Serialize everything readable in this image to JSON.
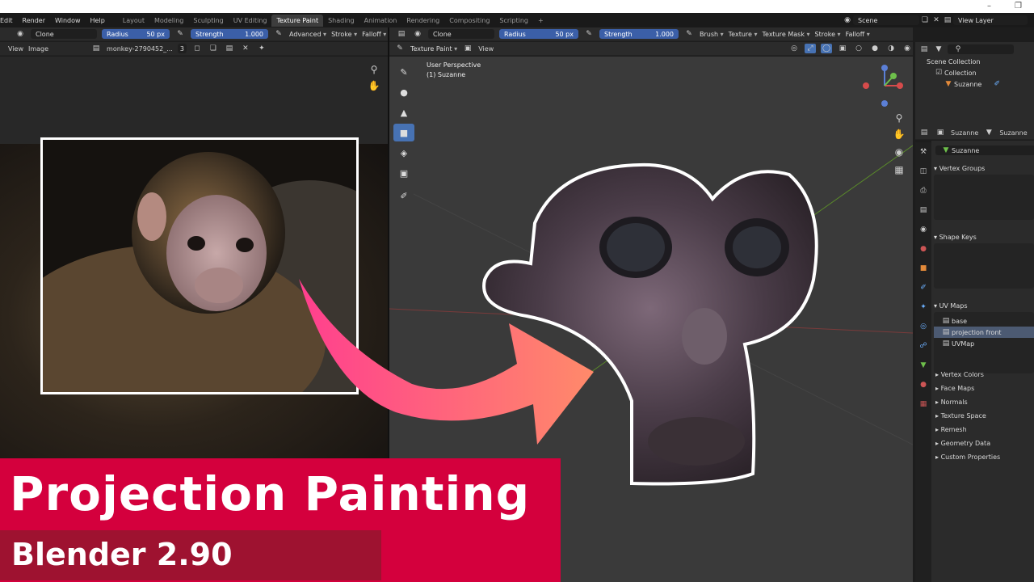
{
  "menu": {
    "items": [
      "Edit",
      "Render",
      "Window",
      "Help"
    ]
  },
  "workspaces": [
    "Layout",
    "Modeling",
    "Sculpting",
    "UV Editing",
    "Texture Paint",
    "Shading",
    "Animation",
    "Rendering",
    "Compositing",
    "Scripting"
  ],
  "active_workspace": "Texture Paint",
  "add_workspace": "+",
  "scene": {
    "label": "Scene",
    "view_layer": "View Layer"
  },
  "left_toolbar": {
    "mode": "Clone",
    "radius_label": "Radius",
    "radius_value": "50 px",
    "strength_label": "Strength",
    "strength_value": "1.000",
    "advanced": "Advanced",
    "stroke": "Stroke",
    "falloff": "Falloff"
  },
  "left_header": {
    "view": "View",
    "image": "Image",
    "image_name": "monkey-2790452_...",
    "users": "3"
  },
  "right_toolbar": {
    "mode": "Clone",
    "radius_label": "Radius",
    "radius_value": "50 px",
    "strength_label": "Strength",
    "strength_value": "1.000",
    "brush": "Brush",
    "texture": "Texture",
    "texture_mask": "Texture Mask",
    "stroke": "Stroke",
    "falloff": "Falloff"
  },
  "viewport_header": {
    "mode": "Texture Paint",
    "view": "View"
  },
  "viewport": {
    "perspective": "User Perspective",
    "object": "(1) Suzanne"
  },
  "outliner": {
    "scene_collection": "Scene Collection",
    "collection": "Collection",
    "object": "Suzanne"
  },
  "properties": {
    "object_name": "Suzanne",
    "data_name": "Suzanne",
    "mesh_name": "Suzanne",
    "vertex_groups": "Vertex Groups",
    "shape_keys": "Shape Keys",
    "uv_maps": "UV Maps",
    "uv_list": [
      "base",
      "projection front",
      "UVMap"
    ],
    "uv_selected_index": 1,
    "collapsed": [
      "Vertex Colors",
      "Face Maps",
      "Normals",
      "Texture Space",
      "Remesh",
      "Geometry Data",
      "Custom Properties"
    ]
  },
  "banner": {
    "title": "Projection Painting",
    "subtitle": "Blender 2.90"
  },
  "colors": {
    "banner": "#d4003d",
    "banner_dark": "#9e1230",
    "arrow_start": "#ff3f8e",
    "arrow_end": "#ff8a6a",
    "accent_blue": "#4772b3"
  }
}
